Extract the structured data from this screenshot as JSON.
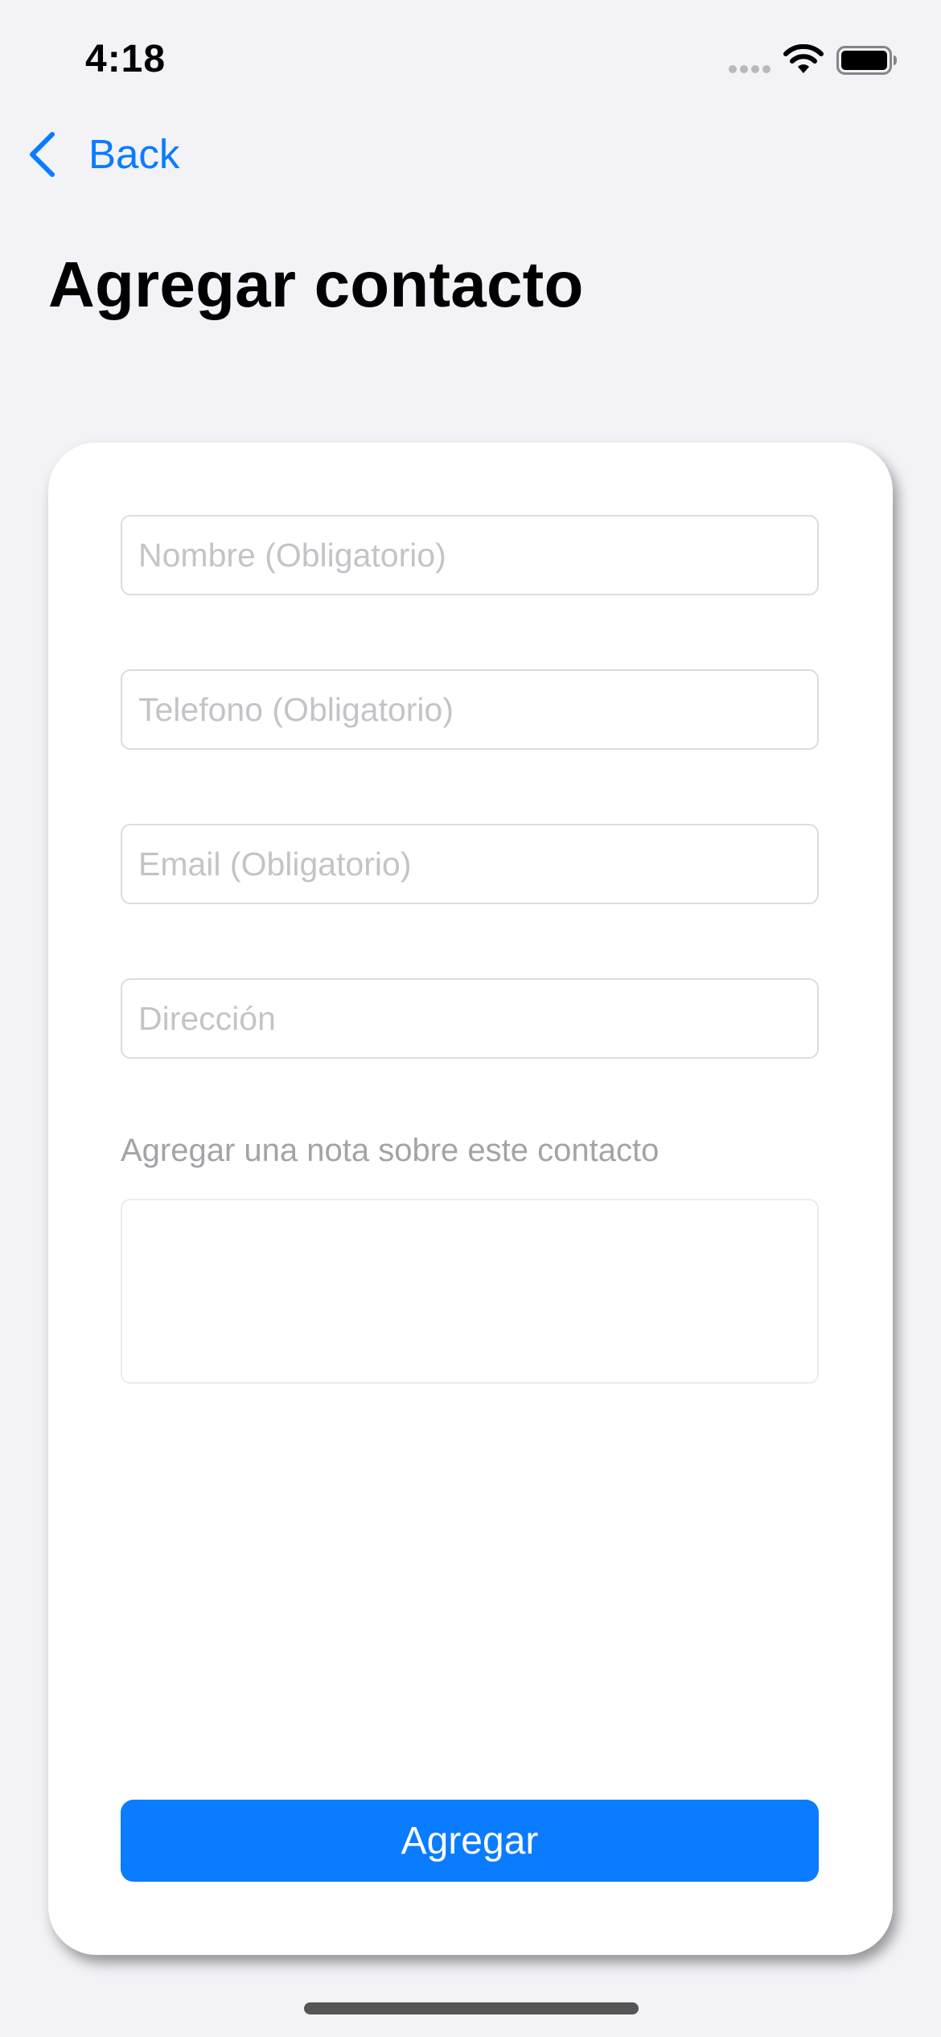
{
  "status_bar": {
    "time": "4:18"
  },
  "nav": {
    "back_label": "Back"
  },
  "page": {
    "title": "Agregar contacto"
  },
  "form": {
    "name": {
      "placeholder": "Nombre (Obligatorio)",
      "value": ""
    },
    "phone": {
      "placeholder": "Telefono (Obligatorio)",
      "value": ""
    },
    "email": {
      "placeholder": "Email (Obligatorio)",
      "value": ""
    },
    "address": {
      "placeholder": "Dirección",
      "value": ""
    },
    "note_label": "Agregar una nota sobre este contacto",
    "note_value": "",
    "submit_label": "Agregar"
  },
  "icons": {
    "back": "chevron-left-icon",
    "wifi": "wifi-icon",
    "battery": "battery-icon",
    "signal": "signal-dots-icon"
  },
  "colors": {
    "accent": "#0a7cff",
    "background": "#f2f2f7",
    "card": "#ffffff",
    "placeholder": "#c4c4c8",
    "note_label": "#a3a3a8"
  }
}
